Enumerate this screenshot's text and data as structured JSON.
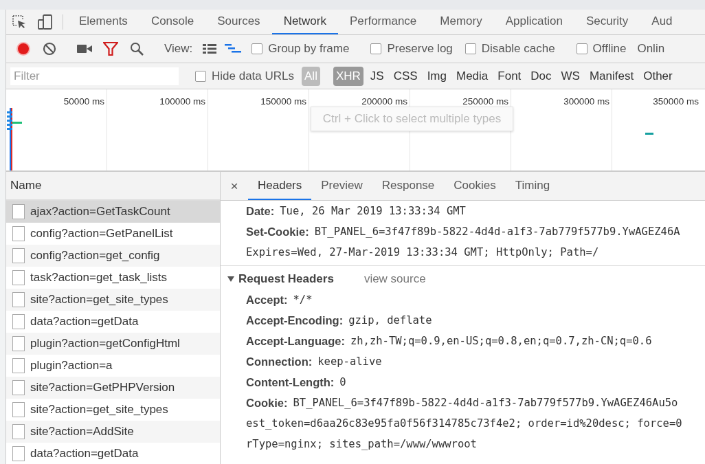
{
  "panel_tabs": [
    {
      "label": "Elements",
      "selected": false
    },
    {
      "label": "Console",
      "selected": false
    },
    {
      "label": "Sources",
      "selected": false
    },
    {
      "label": "Network",
      "selected": true
    },
    {
      "label": "Performance",
      "selected": false
    },
    {
      "label": "Memory",
      "selected": false
    },
    {
      "label": "Application",
      "selected": false
    },
    {
      "label": "Security",
      "selected": false
    },
    {
      "label": "Aud",
      "selected": false
    }
  ],
  "toolbar": {
    "recording": true,
    "filter_shown": true,
    "view_label": "View:",
    "view_buttons": [
      {
        "kind": "list",
        "selected": false
      },
      {
        "kind": "waterfall",
        "selected": true
      }
    ],
    "options": [
      {
        "label": "Group by frame",
        "checked": false
      },
      {
        "label": "Preserve log",
        "checked": false
      },
      {
        "label": "Disable cache",
        "checked": false
      },
      {
        "label": "Offline",
        "checked": false
      }
    ],
    "throttling": "Onlin"
  },
  "filter": {
    "placeholder": "Filter",
    "hide_data_urls": {
      "label": "Hide data URLs",
      "checked": false
    },
    "types": [
      {
        "label": "All",
        "selected": false,
        "hovered": true
      },
      {
        "label": "XHR",
        "selected": true,
        "hovered": false
      },
      {
        "label": "JS",
        "selected": false,
        "hovered": false
      },
      {
        "label": "CSS",
        "selected": false,
        "hovered": false
      },
      {
        "label": "Img",
        "selected": false,
        "hovered": false
      },
      {
        "label": "Media",
        "selected": false,
        "hovered": false
      },
      {
        "label": "Font",
        "selected": false,
        "hovered": false
      },
      {
        "label": "Doc",
        "selected": false,
        "hovered": false
      },
      {
        "label": "WS",
        "selected": false,
        "hovered": false
      },
      {
        "label": "Manifest",
        "selected": false,
        "hovered": false
      },
      {
        "label": "Other",
        "selected": false,
        "hovered": false
      }
    ]
  },
  "overview": {
    "ticks": [
      "50000 ms",
      "100000 ms",
      "150000 ms",
      "200000 ms",
      "250000 ms",
      "300000 ms",
      "350000 ms"
    ],
    "tooltip": "Ctrl + Click to select multiple types"
  },
  "requests": {
    "column": "Name",
    "rows": [
      {
        "name": "ajax?action=GetTaskCount",
        "selected": true
      },
      {
        "name": "config?action=GetPanelList",
        "selected": false
      },
      {
        "name": "config?action=get_config",
        "selected": false
      },
      {
        "name": "task?action=get_task_lists",
        "selected": false
      },
      {
        "name": "site?action=get_site_types",
        "selected": false
      },
      {
        "name": "data?action=getData",
        "selected": false
      },
      {
        "name": "plugin?action=getConfigHtml",
        "selected": false
      },
      {
        "name": "plugin?action=a",
        "selected": false
      },
      {
        "name": "site?action=GetPHPVersion",
        "selected": false
      },
      {
        "name": "site?action=get_site_types",
        "selected": false
      },
      {
        "name": "site?action=AddSite",
        "selected": false
      },
      {
        "name": "data?action=getData",
        "selected": false
      }
    ]
  },
  "details": {
    "close": "×",
    "tabs": [
      {
        "label": "Headers",
        "selected": true
      },
      {
        "label": "Preview",
        "selected": false
      },
      {
        "label": "Response",
        "selected": false
      },
      {
        "label": "Cookies",
        "selected": false
      },
      {
        "label": "Timing",
        "selected": false
      }
    ],
    "response_headers": [
      {
        "name": "Date:",
        "lines": [
          "Tue, 26 Mar 2019 13:33:34 GMT"
        ]
      },
      {
        "name": "Set-Cookie:",
        "lines": [
          "BT_PANEL_6=3f47f89b-5822-4d4d-a1f3-7ab779f577b9.YwAGEZ46A",
          "Expires=Wed, 27-Mar-2019 13:33:34 GMT; HttpOnly; Path=/"
        ]
      }
    ],
    "request_headers": {
      "title": "Request Headers",
      "expanded": true,
      "view_source": "view source",
      "headers": [
        {
          "name": "Accept:",
          "lines": [
            "*/*"
          ]
        },
        {
          "name": "Accept-Encoding:",
          "lines": [
            "gzip, deflate"
          ]
        },
        {
          "name": "Accept-Language:",
          "lines": [
            "zh,zh-TW;q=0.9,en-US;q=0.8,en;q=0.7,zh-CN;q=0.6"
          ]
        },
        {
          "name": "Connection:",
          "lines": [
            "keep-alive"
          ]
        },
        {
          "name": "Content-Length:",
          "lines": [
            "0"
          ]
        },
        {
          "name": "Cookie:",
          "lines": [
            "BT_PANEL_6=3f47f89b-5822-4d4d-a1f3-7ab779f577b9.YwAGEZ46Au5o",
            "est_token=d6aa26c83e95fa0f56f314785c73f4e2; order=id%20desc; force=0",
            "rType=nginx; sites_path=/www/wwwroot"
          ]
        }
      ]
    }
  }
}
